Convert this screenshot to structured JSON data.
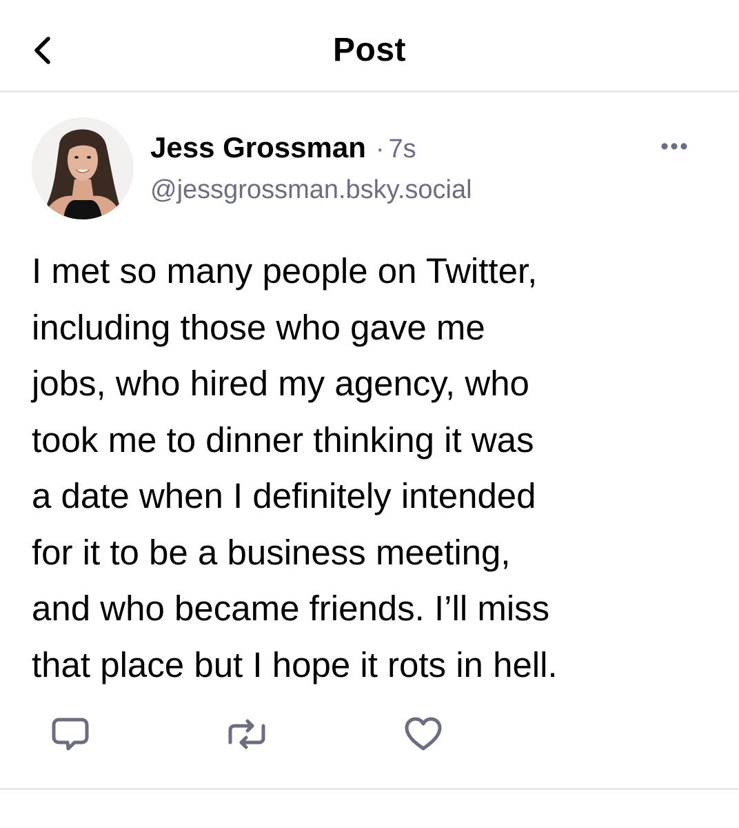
{
  "header": {
    "title": "Post",
    "back_icon": "chevron-left-icon"
  },
  "post": {
    "author_name": "Jess Grossman",
    "separator": "·",
    "time": "7s",
    "handle": "@jessgrossman.bsky.social",
    "text": "I met so many people on Twitter,\nincluding those who gave me\njobs, who hired my agency, who\ntook me to dinner thinking it was\na date when I definitely intended\nfor it to be a business meeting,\nand who became friends. I’ll miss\nthat place but I hope it rots in hell.",
    "more_icon": "ellipsis-icon",
    "actions": [
      {
        "name": "reply",
        "icon": "speech-bubble-icon"
      },
      {
        "name": "repost",
        "icon": "repost-arrows-icon"
      },
      {
        "name": "like",
        "icon": "heart-icon"
      }
    ]
  },
  "colors": {
    "text": "#000000",
    "muted": "#6b6e80",
    "icon": "#6b6e80",
    "divider": "#e8e8ec"
  }
}
